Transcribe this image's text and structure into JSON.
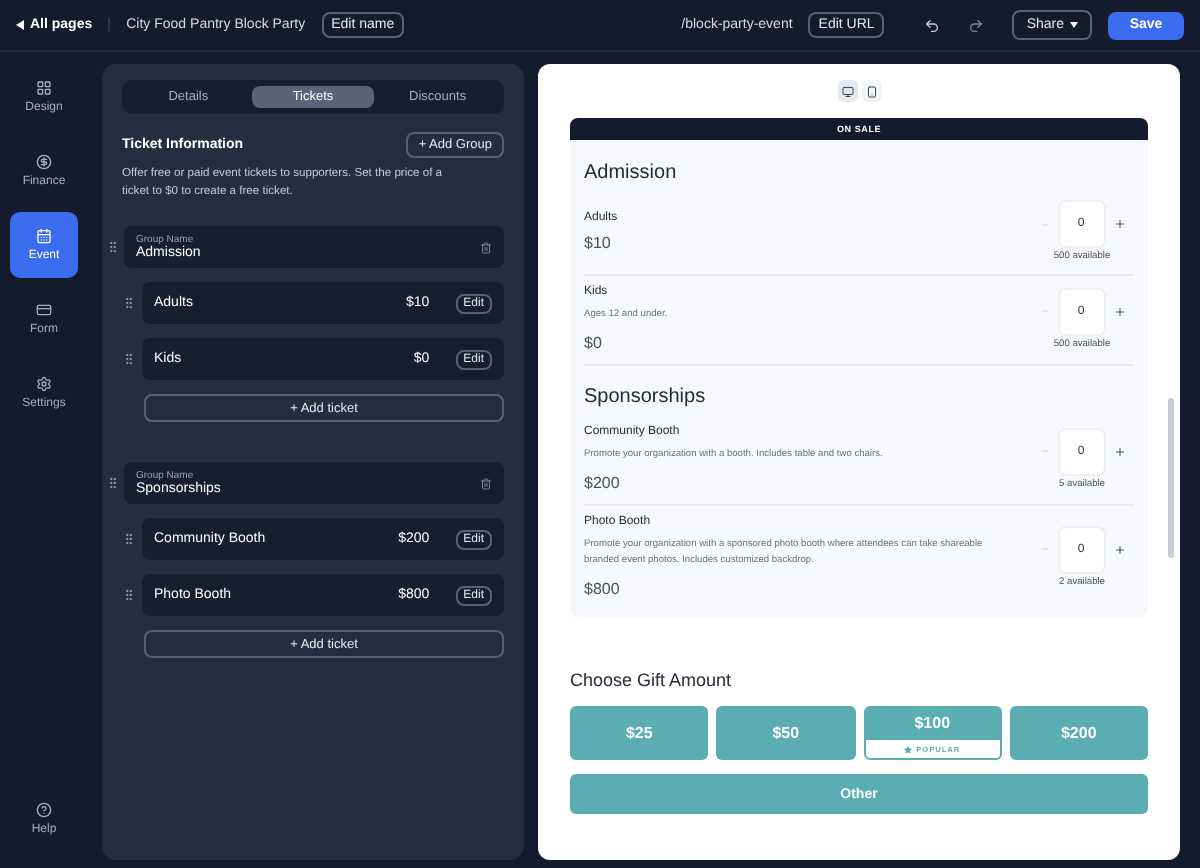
{
  "topbar": {
    "back_link": "All pages",
    "page_name": "City Food Pantry Block Party",
    "edit_name": "Edit name",
    "url": "/block-party-event",
    "edit_url": "Edit URL",
    "share": "Share",
    "save": "Save"
  },
  "sidebar": {
    "items": [
      {
        "label": "Design",
        "selected": false
      },
      {
        "label": "Finance",
        "selected": false
      },
      {
        "label": "Event",
        "selected": true
      },
      {
        "label": "Form",
        "selected": false
      },
      {
        "label": "Settings",
        "selected": false
      }
    ],
    "help": "Help"
  },
  "editor": {
    "tabs": [
      {
        "label": "Details",
        "selected": false
      },
      {
        "label": "Tickets",
        "selected": true
      },
      {
        "label": "Discounts",
        "selected": false
      }
    ],
    "section_title": "Ticket Information",
    "add_group": "+ Add Group",
    "description": "Offer free or paid event tickets to supporters. Set the price of a ticket to $0 to create a free ticket.",
    "groups": [
      {
        "name_label": "Group Name",
        "name": "Admission",
        "add_ticket": "+ Add ticket",
        "tickets": [
          {
            "name": "Adults",
            "price": "$10",
            "edit": "Edit"
          },
          {
            "name": "Kids",
            "price": "$0",
            "edit": "Edit"
          }
        ]
      },
      {
        "name_label": "Group Name",
        "name": "Sponsorships",
        "add_ticket": "+ Add ticket",
        "tickets": [
          {
            "name": "Community Booth",
            "price": "$200",
            "edit": "Edit"
          },
          {
            "name": "Photo Booth",
            "price": "$800",
            "edit": "Edit"
          }
        ]
      }
    ]
  },
  "preview": {
    "view_toggle": [
      {
        "kind": "desktop",
        "selected": true
      },
      {
        "kind": "mobile",
        "selected": false
      }
    ],
    "status": "ON SALE",
    "groups": [
      {
        "title": "Admission",
        "tickets": [
          {
            "name": "Adults",
            "price": "$10",
            "quantity": "0",
            "available": "500 available"
          },
          {
            "name": "Kids",
            "description": "Ages 12 and under.",
            "price": "$0",
            "quantity": "0",
            "available": "500 available"
          }
        ]
      },
      {
        "title": "Sponsorships",
        "tickets": [
          {
            "name": "Community Booth",
            "description": "Promote your organization with a booth. Includes table and two chairs.",
            "price": "$200",
            "quantity": "0",
            "available": "5 available"
          },
          {
            "name": "Photo Booth",
            "description": "Promote your organization with a sponsored photo booth where attendees can take shareable branded event photos. Includes customized backdrop.",
            "price": "$800",
            "quantity": "0",
            "available": "2 available"
          }
        ]
      }
    ],
    "gift": {
      "title": "Choose Gift Amount",
      "amounts": [
        {
          "label": "$25"
        },
        {
          "label": "$50"
        },
        {
          "label": "$100",
          "badge": "POPULAR"
        },
        {
          "label": "$200"
        }
      ],
      "other": "Other"
    }
  }
}
